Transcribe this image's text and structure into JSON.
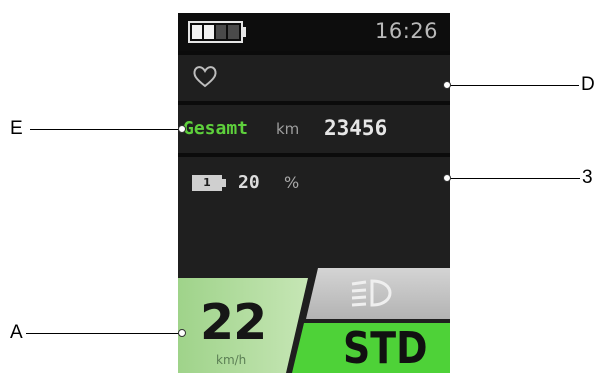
{
  "status_bar": {
    "time": "16:26"
  },
  "total": {
    "label": "Gesamt",
    "unit": "km",
    "value": "23456"
  },
  "battery_row": {
    "battery_number": "1",
    "value": "20",
    "unit": "%"
  },
  "speed": {
    "value": "22",
    "unit": "km/h"
  },
  "mode": {
    "label": "STD"
  },
  "callouts": {
    "d": "D",
    "e": "E",
    "three": "3",
    "a": "A"
  },
  "colors": {
    "screen_bg": "#1f1f1f",
    "accent_green": "#5ed03c",
    "speed_panel": "#9fd38a",
    "mode_panel": "#4ed238",
    "light_panel": "#c9c9c9"
  },
  "icons": [
    "battery-icon",
    "heart-icon",
    "mini-battery-icon",
    "headlight-icon"
  ]
}
